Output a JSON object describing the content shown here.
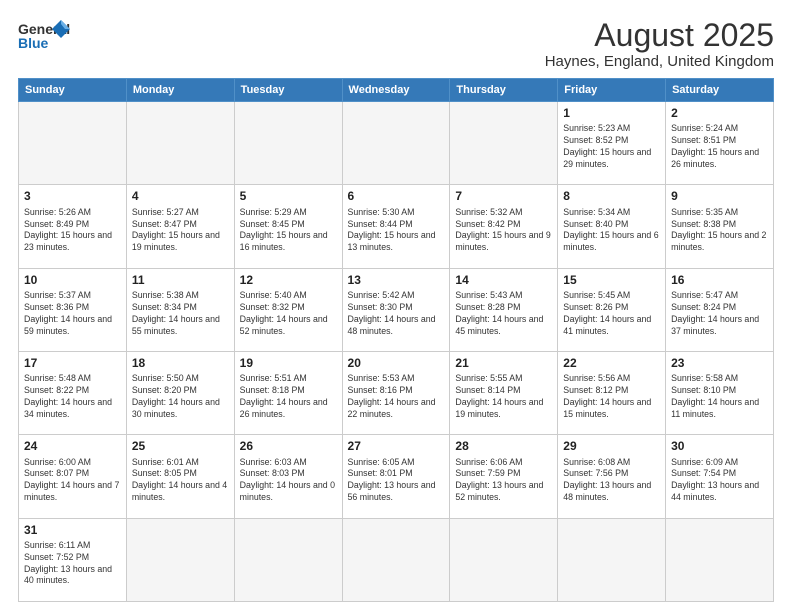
{
  "header": {
    "logo_line1": "General",
    "logo_line2": "Blue",
    "title": "August 2025",
    "subtitle": "Haynes, England, United Kingdom"
  },
  "weekdays": [
    "Sunday",
    "Monday",
    "Tuesday",
    "Wednesday",
    "Thursday",
    "Friday",
    "Saturday"
  ],
  "weeks": [
    [
      {
        "day": "",
        "info": ""
      },
      {
        "day": "",
        "info": ""
      },
      {
        "day": "",
        "info": ""
      },
      {
        "day": "",
        "info": ""
      },
      {
        "day": "",
        "info": ""
      },
      {
        "day": "1",
        "info": "Sunrise: 5:23 AM\nSunset: 8:52 PM\nDaylight: 15 hours and 29 minutes."
      },
      {
        "day": "2",
        "info": "Sunrise: 5:24 AM\nSunset: 8:51 PM\nDaylight: 15 hours and 26 minutes."
      }
    ],
    [
      {
        "day": "3",
        "info": "Sunrise: 5:26 AM\nSunset: 8:49 PM\nDaylight: 15 hours and 23 minutes."
      },
      {
        "day": "4",
        "info": "Sunrise: 5:27 AM\nSunset: 8:47 PM\nDaylight: 15 hours and 19 minutes."
      },
      {
        "day": "5",
        "info": "Sunrise: 5:29 AM\nSunset: 8:45 PM\nDaylight: 15 hours and 16 minutes."
      },
      {
        "day": "6",
        "info": "Sunrise: 5:30 AM\nSunset: 8:44 PM\nDaylight: 15 hours and 13 minutes."
      },
      {
        "day": "7",
        "info": "Sunrise: 5:32 AM\nSunset: 8:42 PM\nDaylight: 15 hours and 9 minutes."
      },
      {
        "day": "8",
        "info": "Sunrise: 5:34 AM\nSunset: 8:40 PM\nDaylight: 15 hours and 6 minutes."
      },
      {
        "day": "9",
        "info": "Sunrise: 5:35 AM\nSunset: 8:38 PM\nDaylight: 15 hours and 2 minutes."
      }
    ],
    [
      {
        "day": "10",
        "info": "Sunrise: 5:37 AM\nSunset: 8:36 PM\nDaylight: 14 hours and 59 minutes."
      },
      {
        "day": "11",
        "info": "Sunrise: 5:38 AM\nSunset: 8:34 PM\nDaylight: 14 hours and 55 minutes."
      },
      {
        "day": "12",
        "info": "Sunrise: 5:40 AM\nSunset: 8:32 PM\nDaylight: 14 hours and 52 minutes."
      },
      {
        "day": "13",
        "info": "Sunrise: 5:42 AM\nSunset: 8:30 PM\nDaylight: 14 hours and 48 minutes."
      },
      {
        "day": "14",
        "info": "Sunrise: 5:43 AM\nSunset: 8:28 PM\nDaylight: 14 hours and 45 minutes."
      },
      {
        "day": "15",
        "info": "Sunrise: 5:45 AM\nSunset: 8:26 PM\nDaylight: 14 hours and 41 minutes."
      },
      {
        "day": "16",
        "info": "Sunrise: 5:47 AM\nSunset: 8:24 PM\nDaylight: 14 hours and 37 minutes."
      }
    ],
    [
      {
        "day": "17",
        "info": "Sunrise: 5:48 AM\nSunset: 8:22 PM\nDaylight: 14 hours and 34 minutes."
      },
      {
        "day": "18",
        "info": "Sunrise: 5:50 AM\nSunset: 8:20 PM\nDaylight: 14 hours and 30 minutes."
      },
      {
        "day": "19",
        "info": "Sunrise: 5:51 AM\nSunset: 8:18 PM\nDaylight: 14 hours and 26 minutes."
      },
      {
        "day": "20",
        "info": "Sunrise: 5:53 AM\nSunset: 8:16 PM\nDaylight: 14 hours and 22 minutes."
      },
      {
        "day": "21",
        "info": "Sunrise: 5:55 AM\nSunset: 8:14 PM\nDaylight: 14 hours and 19 minutes."
      },
      {
        "day": "22",
        "info": "Sunrise: 5:56 AM\nSunset: 8:12 PM\nDaylight: 14 hours and 15 minutes."
      },
      {
        "day": "23",
        "info": "Sunrise: 5:58 AM\nSunset: 8:10 PM\nDaylight: 14 hours and 11 minutes."
      }
    ],
    [
      {
        "day": "24",
        "info": "Sunrise: 6:00 AM\nSunset: 8:07 PM\nDaylight: 14 hours and 7 minutes."
      },
      {
        "day": "25",
        "info": "Sunrise: 6:01 AM\nSunset: 8:05 PM\nDaylight: 14 hours and 4 minutes."
      },
      {
        "day": "26",
        "info": "Sunrise: 6:03 AM\nSunset: 8:03 PM\nDaylight: 14 hours and 0 minutes."
      },
      {
        "day": "27",
        "info": "Sunrise: 6:05 AM\nSunset: 8:01 PM\nDaylight: 13 hours and 56 minutes."
      },
      {
        "day": "28",
        "info": "Sunrise: 6:06 AM\nSunset: 7:59 PM\nDaylight: 13 hours and 52 minutes."
      },
      {
        "day": "29",
        "info": "Sunrise: 6:08 AM\nSunset: 7:56 PM\nDaylight: 13 hours and 48 minutes."
      },
      {
        "day": "30",
        "info": "Sunrise: 6:09 AM\nSunset: 7:54 PM\nDaylight: 13 hours and 44 minutes."
      }
    ],
    [
      {
        "day": "31",
        "info": "Sunrise: 6:11 AM\nSunset: 7:52 PM\nDaylight: 13 hours and 40 minutes."
      },
      {
        "day": "",
        "info": ""
      },
      {
        "day": "",
        "info": ""
      },
      {
        "day": "",
        "info": ""
      },
      {
        "day": "",
        "info": ""
      },
      {
        "day": "",
        "info": ""
      },
      {
        "day": "",
        "info": ""
      }
    ]
  ]
}
